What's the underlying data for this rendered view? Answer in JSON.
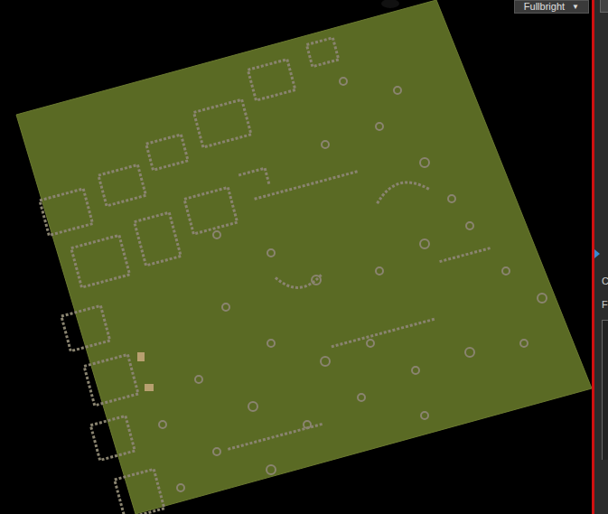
{
  "viewport": {
    "render_mode": "Fullbright",
    "dropdown_arrow": "▼"
  },
  "side_panel": {
    "labels": [
      "C",
      "F"
    ]
  }
}
